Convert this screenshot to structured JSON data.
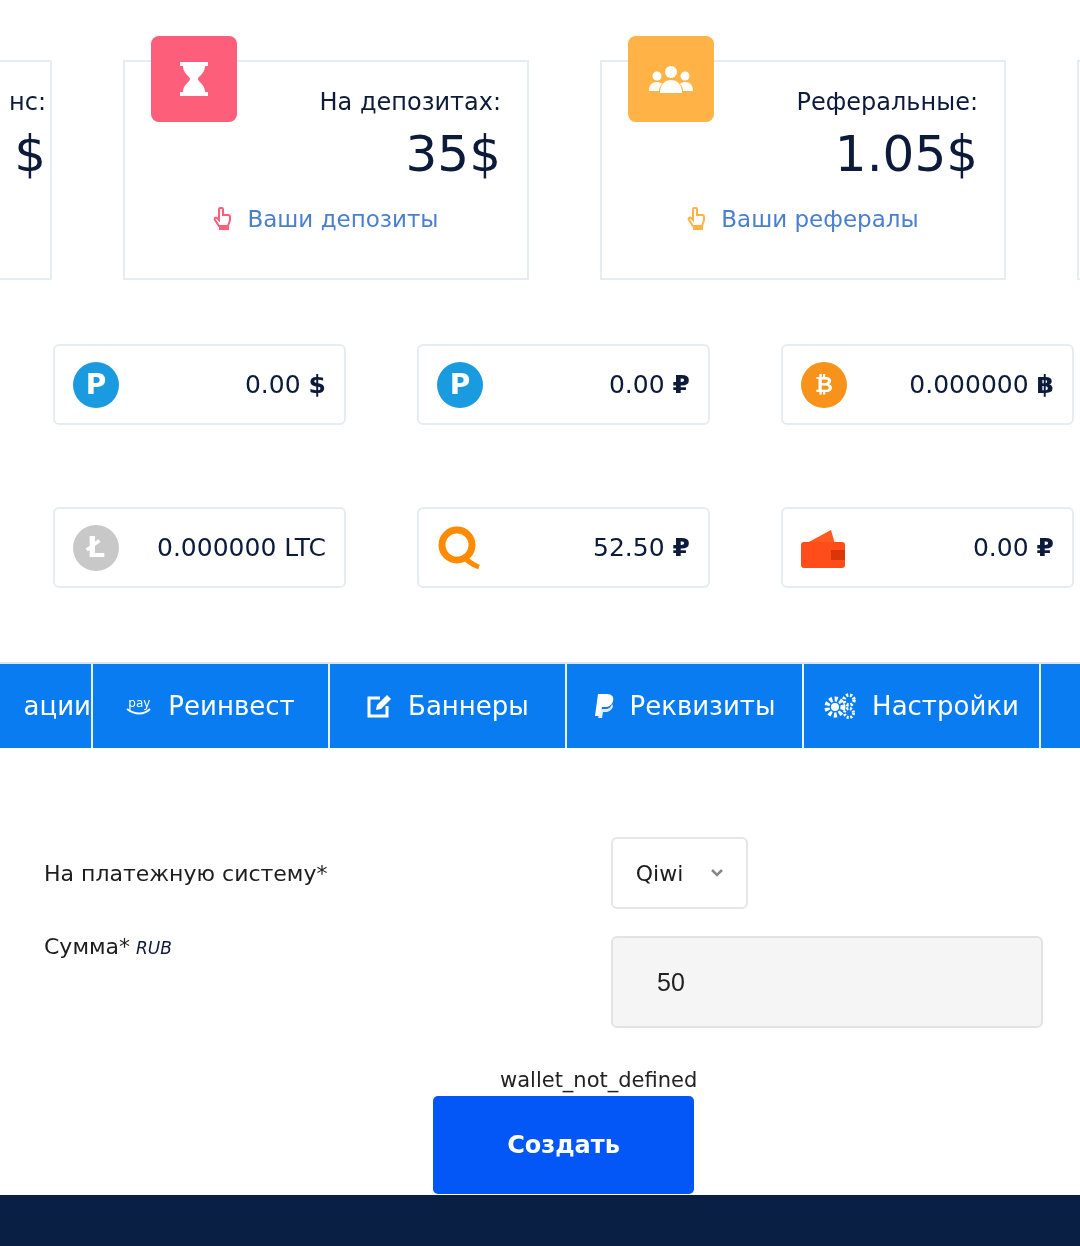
{
  "stats": [
    {
      "label": "нс:",
      "value": "$"
    },
    {
      "label": "На депозитах:",
      "value": "35$",
      "link": "Ваши депозиты",
      "color": "#fd5f7a",
      "kind": "hourglass"
    },
    {
      "label": "Реферальные:",
      "value": "1.05$",
      "link": "Ваши рефералы",
      "color": "#ffb347",
      "kind": "users"
    }
  ],
  "wallets": [
    {
      "kind": "payeer",
      "badge": "P",
      "amount": "0.00 **$**"
    },
    {
      "kind": "payeer",
      "badge": "P",
      "amount": "0.00 **₽**"
    },
    {
      "kind": "bitcoin",
      "badge": "₿",
      "amount": "0.000000 **฿**"
    },
    {
      "kind": "litecoin",
      "badge": "Ł",
      "amount": "0.000000 LTC"
    },
    {
      "kind": "qiwi",
      "amount": "52.50 **₽**"
    },
    {
      "kind": "wallet",
      "amount": "0.00 **₽**"
    }
  ],
  "tabs": [
    {
      "label": "ации"
    },
    {
      "label": "Реинвест",
      "kind": "pay",
      "icon_label": "pay"
    },
    {
      "label": "Баннеры",
      "kind": "edit"
    },
    {
      "label": "Реквизиты",
      "kind": "paypal"
    },
    {
      "label": "Настройки",
      "kind": "gears"
    }
  ],
  "form": {
    "system_label": "На платежную систему*",
    "system_value": "Qiwi",
    "amount_label": "Сумма*",
    "amount_unit": "RUB",
    "amount_value": "50",
    "warning": "wallet_not_defined",
    "submit": "Создать"
  }
}
